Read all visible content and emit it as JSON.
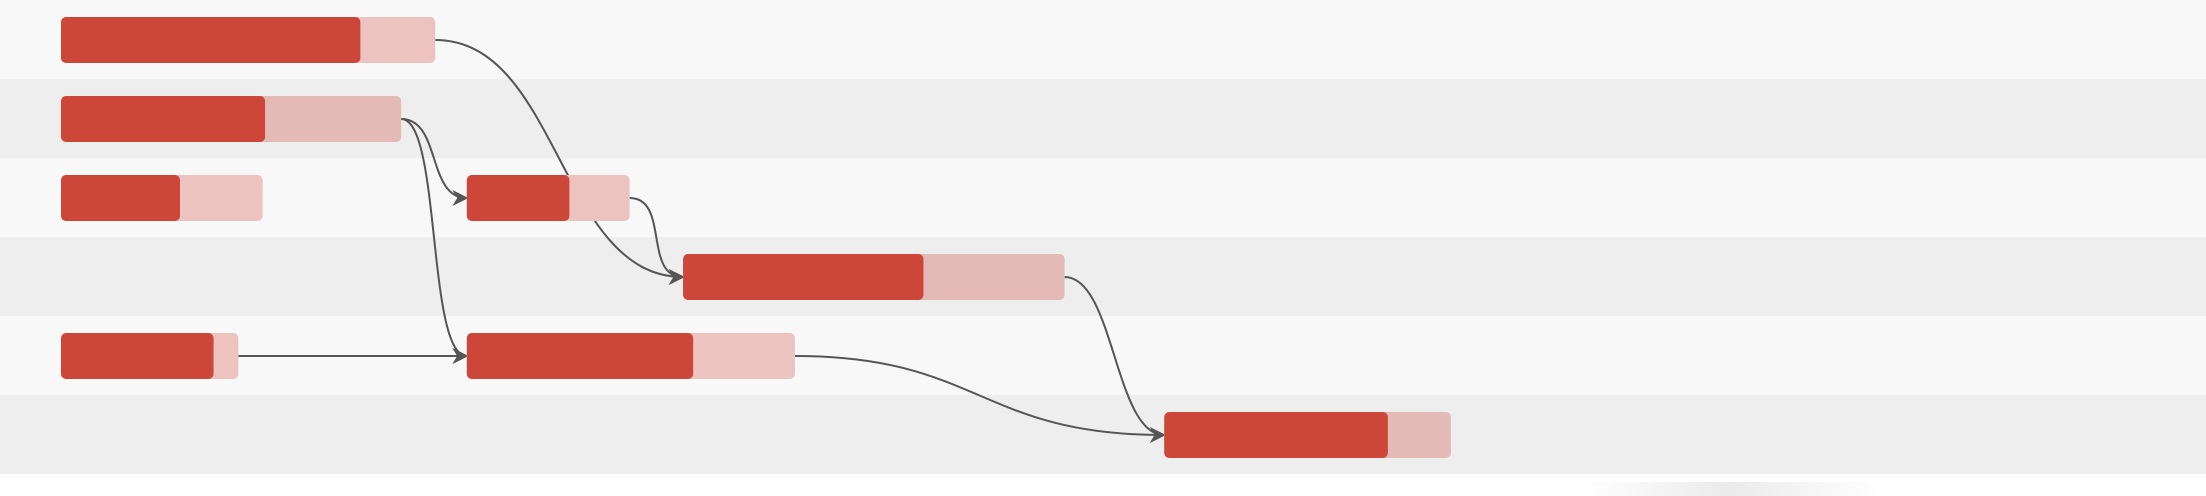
{
  "chart_data": {
    "type": "gantt",
    "title": "",
    "x_range": [
      0,
      100
    ],
    "rows": 6,
    "tasks": [
      {
        "id": "t1",
        "row": 0,
        "start": 0.0,
        "end": 15.4,
        "progress": 80
      },
      {
        "id": "t2",
        "row": 1,
        "start": 0.0,
        "end": 14.0,
        "progress": 60
      },
      {
        "id": "t3",
        "row": 2,
        "start": 0.0,
        "end": 8.3,
        "progress": 59
      },
      {
        "id": "t4",
        "row": 2,
        "start": 16.7,
        "end": 23.4,
        "progress": 63
      },
      {
        "id": "t5",
        "row": 3,
        "start": 25.6,
        "end": 41.3,
        "progress": 63
      },
      {
        "id": "t6",
        "row": 4,
        "start": 0.0,
        "end": 7.3,
        "progress": 86
      },
      {
        "id": "t7",
        "row": 4,
        "start": 16.7,
        "end": 30.2,
        "progress": 69
      },
      {
        "id": "t8",
        "row": 5,
        "start": 45.4,
        "end": 57.2,
        "progress": 78
      }
    ],
    "dependencies": [
      {
        "from": "t1",
        "to": "t5"
      },
      {
        "from": "t2",
        "to": "t4"
      },
      {
        "from": "t2",
        "to": "t7"
      },
      {
        "from": "t4",
        "to": "t5"
      },
      {
        "from": "t6",
        "to": "t7"
      },
      {
        "from": "t5",
        "to": "t8"
      },
      {
        "from": "t7",
        "to": "t8"
      }
    ],
    "colors": {
      "progress": "#cc473a",
      "remaining": "#ecc3bf",
      "remaining_shaded_row": "#e3bab6",
      "row_light": "#f8f8f8",
      "row_dark": "#eeeeee",
      "dependency": "#555555"
    }
  }
}
